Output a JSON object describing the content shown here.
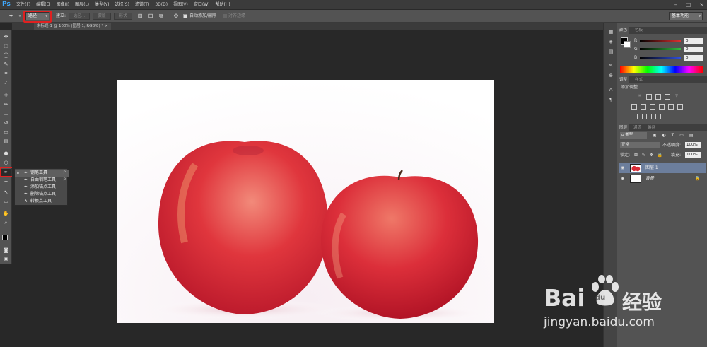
{
  "app": {
    "logo": "Ps"
  },
  "menu": [
    "文件(F)",
    "编辑(E)",
    "图像(I)",
    "图层(L)",
    "类型(Y)",
    "选择(S)",
    "滤镜(T)",
    "3D(D)",
    "视图(V)",
    "窗口(W)",
    "帮助(H)"
  ],
  "options": {
    "mode": "路径",
    "make_label": "建立:",
    "btn_selection": "选区...",
    "btn_mask": "蒙版",
    "btn_shape": "形状",
    "auto_add_delete": "自动添加/删除",
    "align_edges": "对齐边缘",
    "workspace": "基本功能"
  },
  "document": {
    "tab": "未标题-1 @ 100% (图层 1, RGB/8) *"
  },
  "flyout": [
    {
      "label": "钢笔工具",
      "key": "P",
      "icon": "pen-icon",
      "selected": true
    },
    {
      "label": "自由钢笔工具",
      "key": "P",
      "icon": "freeform-pen-icon",
      "selected": false
    },
    {
      "label": "添加锚点工具",
      "key": "",
      "icon": "add-anchor-icon",
      "selected": false
    },
    {
      "label": "删除锚点工具",
      "key": "",
      "icon": "delete-anchor-icon",
      "selected": false
    },
    {
      "label": "转换点工具",
      "key": "",
      "icon": "convert-point-icon",
      "selected": false
    }
  ],
  "color_panel": {
    "tabs": [
      "颜色",
      "色板"
    ],
    "channels": [
      {
        "label": "R",
        "value": "0",
        "color": "#e03030"
      },
      {
        "label": "G",
        "value": "0",
        "color": "#30c040"
      },
      {
        "label": "B",
        "value": "0",
        "color": "#3050e0"
      }
    ]
  },
  "adjust_panel": {
    "tabs": [
      "调整",
      "样式"
    ],
    "title": "添加调整"
  },
  "layers_panel": {
    "tabs": [
      "图层",
      "通道",
      "路径"
    ],
    "filter": "ρ 类型",
    "blend_mode": "正常",
    "opacity_label": "不透明度:",
    "opacity": "100%",
    "lock_label": "锁定:",
    "fill_label": "填充:",
    "fill": "100%",
    "layers": [
      {
        "name": "图层 1",
        "selected": true,
        "lock": ""
      },
      {
        "name": "背景",
        "selected": false,
        "lock": "🔒"
      }
    ]
  },
  "watermark": {
    "brand": "Bai",
    "brand2": "du",
    "product": "经验",
    "url": "jingyan.baidu.com"
  },
  "colors": {
    "accent": "#3fa9ff",
    "highlight": "#e02020",
    "layer_selected": "#6c7e9c"
  }
}
